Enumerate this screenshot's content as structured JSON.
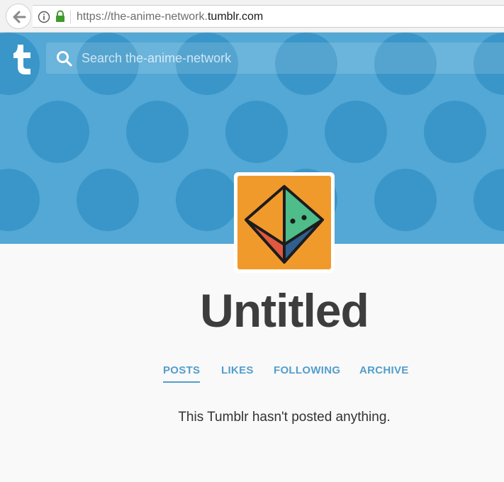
{
  "browser": {
    "url_scheme": "https://",
    "url_subdomain": "the-anime-network.",
    "url_domain": "tumblr.com"
  },
  "header": {
    "logo_text": "t",
    "search_placeholder": "Search the-anime-network",
    "pattern_color": "#3a96c9",
    "background_color": "#53a8d5"
  },
  "blog": {
    "title": "Untitled",
    "avatar_bg_color": "#f19a2c"
  },
  "tabs": [
    {
      "label": "POSTS",
      "active": true
    },
    {
      "label": "LIKES",
      "active": false
    },
    {
      "label": "FOLLOWING",
      "active": false
    },
    {
      "label": "ARCHIVE",
      "active": false
    }
  ],
  "content": {
    "empty_message": "This Tumblr hasn't posted anything."
  },
  "colors": {
    "accent": "#529ecc",
    "title": "#3d3d3d"
  }
}
